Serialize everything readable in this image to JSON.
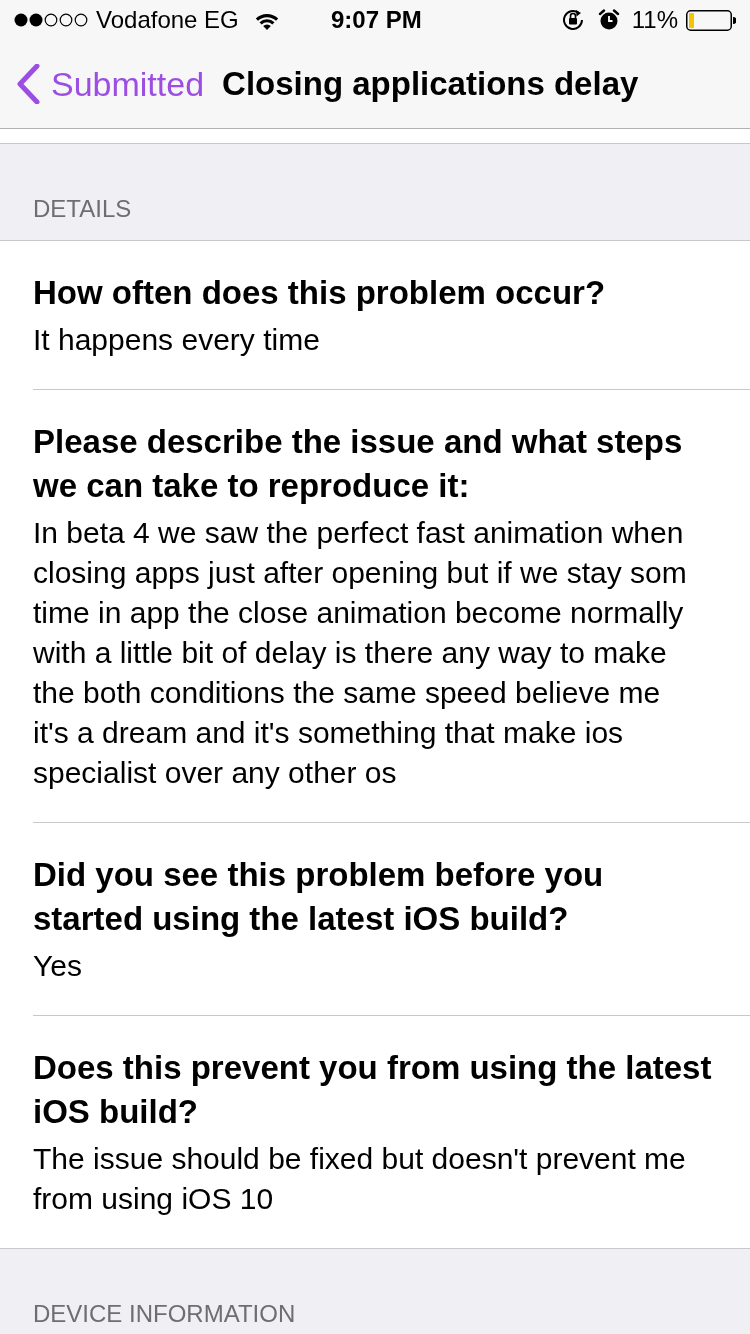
{
  "status_bar": {
    "carrier": "Vodafone EG",
    "time": "9:07 PM",
    "battery": "11%"
  },
  "nav_bar": {
    "back": "Submitted",
    "title": "Closing applications delay"
  },
  "sections": [
    {
      "header": "DETAILS",
      "items": [
        {
          "question": "How often does this problem occur?",
          "answer": "It happens every time"
        },
        {
          "question": "Please describe the issue and what steps we can take to reproduce it:",
          "answer": "In beta 4 we saw the perfect fast animation when closing apps just after opening but if we stay som time in app the close animation become normally with a little bit of delay is there any way to make the both conditions the same speed believe me it's a dream and it's something that make ios specialist over any other os"
        },
        {
          "question": "Did you see this problem before you started using the latest iOS build?",
          "answer": "Yes"
        },
        {
          "question": "Does this prevent you from using the latest iOS build?",
          "answer": "The issue should be fixed but doesn't prevent me from using iOS 10"
        }
      ]
    },
    {
      "header": "DEVICE INFORMATION"
    }
  ]
}
